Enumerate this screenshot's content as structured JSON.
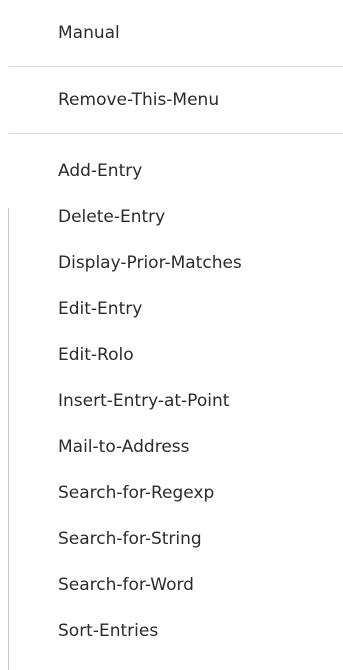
{
  "menu": {
    "top_items": [
      {
        "label": "Manual"
      }
    ],
    "middle_items": [
      {
        "label": "Remove-This-Menu"
      }
    ],
    "main_items": [
      {
        "label": "Add-Entry"
      },
      {
        "label": "Delete-Entry"
      },
      {
        "label": "Display-Prior-Matches"
      },
      {
        "label": "Edit-Entry"
      },
      {
        "label": "Edit-Rolo"
      },
      {
        "label": "Insert-Entry-at-Point"
      },
      {
        "label": "Mail-to-Address"
      },
      {
        "label": "Search-for-Regexp"
      },
      {
        "label": "Search-for-String"
      },
      {
        "label": "Search-for-Word"
      },
      {
        "label": "Sort-Entries"
      }
    ]
  },
  "colors": {
    "background": "#ffffff",
    "text": "#2b2b2b",
    "separator": "#d8d8d8"
  }
}
